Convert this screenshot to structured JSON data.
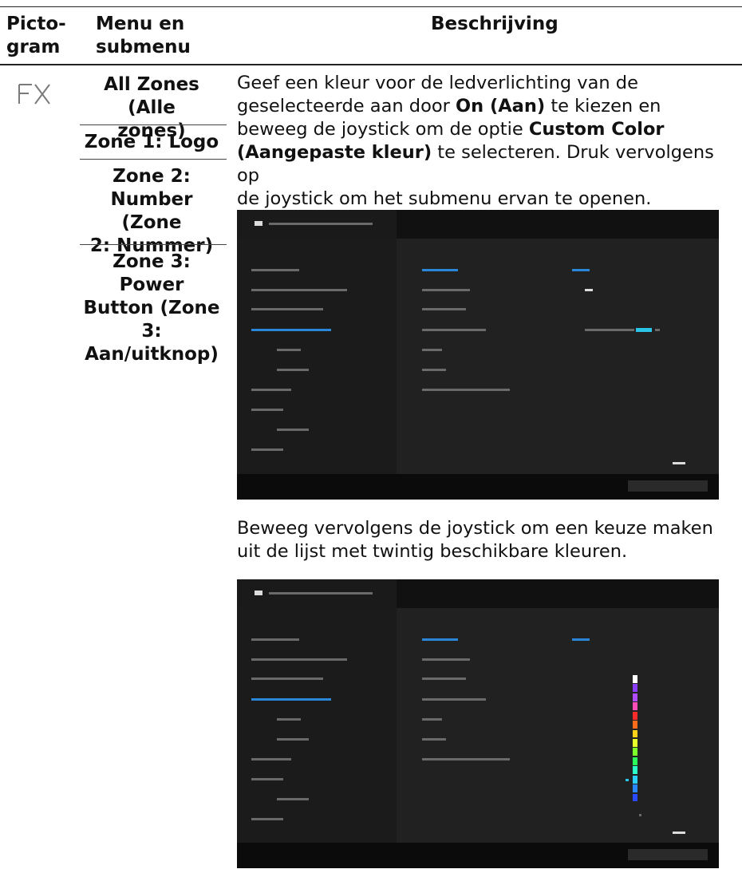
{
  "header": {
    "col1": [
      "Picto-",
      "gram"
    ],
    "col2": [
      "Menu en",
      "submenu"
    ],
    "col3": "Beschrijving"
  },
  "row": {
    "icon": "fx-icon",
    "zones": [
      [
        "All Zones (Alle",
        "zones)"
      ],
      [
        "Zone 1: Logo"
      ],
      [
        "Zone 2:",
        "Number (Zone",
        "2: Nummer)"
      ],
      [
        "Zone 3: Power",
        "Button (Zone 3:",
        "Aan/uitknop)"
      ]
    ],
    "description1": {
      "line1": "Geef een kleur voor de ledverlichting van de",
      "line2_pre": "geselecteerde aan door ",
      "line2_bold": "On (Aan)",
      "line2_post": " te kiezen en",
      "line3_pre": "beweeg de joystick om de optie ",
      "line3_bold": "Custom Color",
      "line4_bold": "(Aangepaste kleur)",
      "line4_post": " te selecteren. Druk vervolgens op",
      "line5": "de joystick om het submenu ervan te openen."
    },
    "description2": {
      "line1": "Beweeg vervolgens de joystick om een keuze maken",
      "line2": "uit de lijst met twintig beschikbare kleuren."
    }
  },
  "colors": {
    "osd_accent": "#2a86d9",
    "osd_highlight": "#29c4e8"
  },
  "color_strip": [
    "#ffffff",
    "#8a3cff",
    "#b04bff",
    "#ff4db8",
    "#ff2a2a",
    "#ff6a1a",
    "#ffd21a",
    "#e8ff2a",
    "#7dff2a",
    "#2aff5a",
    "#2affc8",
    "#2ad0ff",
    "#2a86ff",
    "#2a4aff"
  ]
}
